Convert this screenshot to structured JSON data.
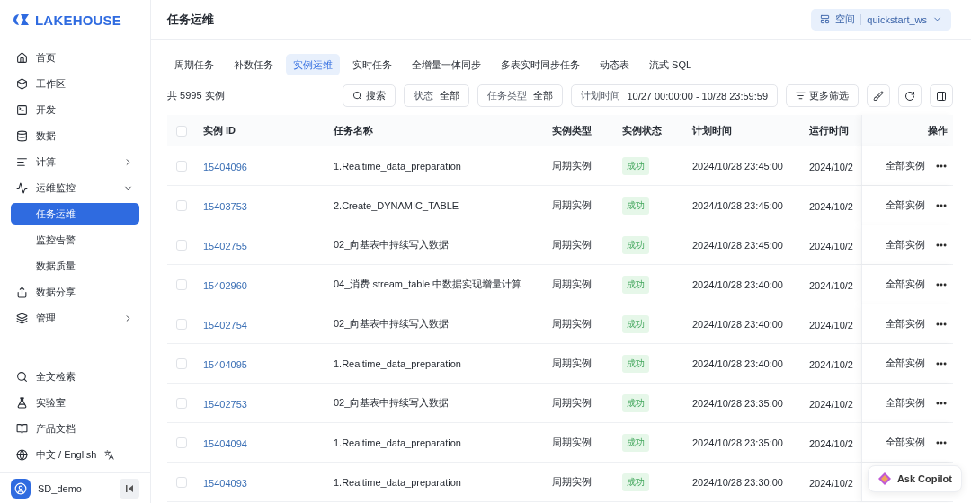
{
  "brand": {
    "name": "LAKEHOUSE"
  },
  "sidebar": {
    "items": [
      {
        "label": "首页",
        "kind": "link",
        "selected": false
      },
      {
        "label": "工作区",
        "kind": "link",
        "selected": false
      },
      {
        "label": "开发",
        "kind": "link",
        "selected": false
      },
      {
        "label": "数据",
        "kind": "link",
        "selected": false
      },
      {
        "label": "计算",
        "kind": "group",
        "expanded": false,
        "selected": false
      },
      {
        "label": "运维监控",
        "kind": "group",
        "expanded": true,
        "selected": false,
        "children": [
          {
            "label": "任务运维",
            "selected": true
          },
          {
            "label": "监控告警",
            "selected": false
          },
          {
            "label": "数据质量",
            "selected": false
          }
        ]
      },
      {
        "label": "数据分享",
        "kind": "link",
        "selected": false
      },
      {
        "label": "管理",
        "kind": "group",
        "expanded": false,
        "selected": false
      }
    ],
    "bottom_items": [
      {
        "label": "全文检索"
      },
      {
        "label": "实验室"
      },
      {
        "label": "产品文档"
      },
      {
        "label": "中文 / English"
      }
    ],
    "user": {
      "name": "SD_demo"
    }
  },
  "header": {
    "title": "任务运维",
    "workspace": {
      "label": "空间",
      "value": "quickstart_ws"
    }
  },
  "tabs": [
    {
      "label": "周期任务",
      "selected": false
    },
    {
      "label": "补数任务",
      "selected": false
    },
    {
      "label": "实例运维",
      "selected": true
    },
    {
      "label": "实时任务",
      "selected": false
    },
    {
      "label": "全增量一体同步",
      "selected": false
    },
    {
      "label": "多表实时同步任务",
      "selected": false
    },
    {
      "label": "动态表",
      "selected": false
    },
    {
      "label": "流式 SQL",
      "selected": false
    }
  ],
  "toolbar": {
    "count": "共 5995 实例",
    "search": "搜索",
    "filters": [
      {
        "label": "状态",
        "value": "全部"
      },
      {
        "label": "任务类型",
        "value": "全部"
      },
      {
        "label": "计划时间",
        "value": "10/27 00:00:00 - 10/28 23:59:59"
      }
    ],
    "more": "更多筛选"
  },
  "table": {
    "header_checked": false,
    "columns": [
      "实例 ID",
      "任务名称",
      "实例类型",
      "实例状态",
      "计划时间",
      "运行时间",
      "操作"
    ],
    "rows": [
      {
        "checked": false,
        "id": "15404096",
        "name": "1.Realtime_data_preparation",
        "type": "周期实例",
        "status": "成功",
        "planned": "2024/10/28 23:45:00",
        "run": "2024/10/2",
        "action": "全部实例"
      },
      {
        "checked": false,
        "id": "15403753",
        "name": "2.Create_DYNAMIC_TABLE",
        "type": "周期实例",
        "status": "成功",
        "planned": "2024/10/28 23:45:00",
        "run": "2024/10/2",
        "action": "全部实例"
      },
      {
        "checked": false,
        "id": "15402755",
        "name": "02_向基表中持续写入数据",
        "type": "周期实例",
        "status": "成功",
        "planned": "2024/10/28 23:45:00",
        "run": "2024/10/2",
        "action": "全部实例"
      },
      {
        "checked": false,
        "id": "15402960",
        "name": "04_消费 stream_table 中数据实现增量计算",
        "type": "周期实例",
        "status": "成功",
        "planned": "2024/10/28 23:40:00",
        "run": "2024/10/2",
        "action": "全部实例"
      },
      {
        "checked": false,
        "id": "15402754",
        "name": "02_向基表中持续写入数据",
        "type": "周期实例",
        "status": "成功",
        "planned": "2024/10/28 23:40:00",
        "run": "2024/10/2",
        "action": "全部实例"
      },
      {
        "checked": false,
        "id": "15404095",
        "name": "1.Realtime_data_preparation",
        "type": "周期实例",
        "status": "成功",
        "planned": "2024/10/28 23:40:00",
        "run": "2024/10/2",
        "action": "全部实例"
      },
      {
        "checked": false,
        "id": "15402753",
        "name": "02_向基表中持续写入数据",
        "type": "周期实例",
        "status": "成功",
        "planned": "2024/10/28 23:35:00",
        "run": "2024/10/2",
        "action": "全部实例"
      },
      {
        "checked": false,
        "id": "15404094",
        "name": "1.Realtime_data_preparation",
        "type": "周期实例",
        "status": "成功",
        "planned": "2024/10/28 23:35:00",
        "run": "2024/10/2",
        "action": "全部实例"
      },
      {
        "checked": false,
        "id": "15404093",
        "name": "1.Realtime_data_preparation",
        "type": "周期实例",
        "status": "成功",
        "planned": "2024/10/28 23:30:00",
        "run": "2024/10/2"
      }
    ]
  },
  "copilot": {
    "label": "Ask Copilot"
  }
}
